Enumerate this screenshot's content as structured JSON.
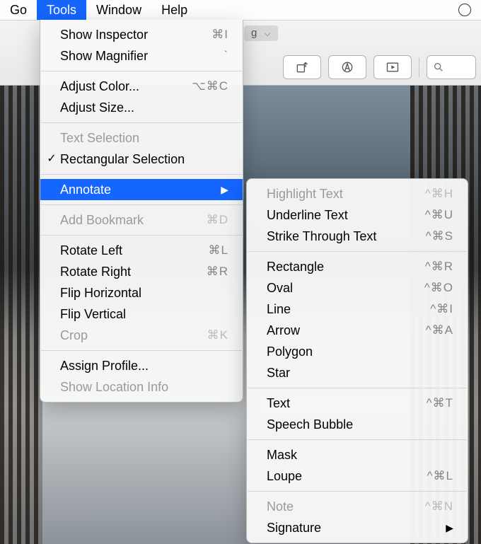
{
  "menubar": {
    "go": "Go",
    "tools": "Tools",
    "window": "Window",
    "help": "Help"
  },
  "toolbar": {
    "filename_partial": "g"
  },
  "tools_menu": {
    "show_inspector": {
      "label": "Show Inspector",
      "shortcut": "⌘I"
    },
    "show_magnifier": {
      "label": "Show Magnifier",
      "shortcut": "`"
    },
    "adjust_color": {
      "label": "Adjust Color...",
      "shortcut": "⌥⌘C"
    },
    "adjust_size": {
      "label": "Adjust Size..."
    },
    "text_selection": {
      "label": "Text Selection"
    },
    "rectangular_selection": {
      "label": "Rectangular Selection"
    },
    "annotate": {
      "label": "Annotate"
    },
    "add_bookmark": {
      "label": "Add Bookmark",
      "shortcut": "⌘D"
    },
    "rotate_left": {
      "label": "Rotate Left",
      "shortcut": "⌘L"
    },
    "rotate_right": {
      "label": "Rotate Right",
      "shortcut": "⌘R"
    },
    "flip_horizontal": {
      "label": "Flip Horizontal"
    },
    "flip_vertical": {
      "label": "Flip Vertical"
    },
    "crop": {
      "label": "Crop",
      "shortcut": "⌘K"
    },
    "assign_profile": {
      "label": "Assign Profile..."
    },
    "show_location_info": {
      "label": "Show Location Info"
    }
  },
  "annotate_menu": {
    "highlight_text": {
      "label": "Highlight Text",
      "shortcut": "^⌘H"
    },
    "underline_text": {
      "label": "Underline Text",
      "shortcut": "^⌘U"
    },
    "strike_through_text": {
      "label": "Strike Through Text",
      "shortcut": "^⌘S"
    },
    "rectangle": {
      "label": "Rectangle",
      "shortcut": "^⌘R"
    },
    "oval": {
      "label": "Oval",
      "shortcut": "^⌘O"
    },
    "line": {
      "label": "Line",
      "shortcut": "^⌘I"
    },
    "arrow": {
      "label": "Arrow",
      "shortcut": "^⌘A"
    },
    "polygon": {
      "label": "Polygon"
    },
    "star": {
      "label": "Star"
    },
    "text": {
      "label": "Text",
      "shortcut": "^⌘T"
    },
    "speech_bubble": {
      "label": "Speech Bubble"
    },
    "mask": {
      "label": "Mask"
    },
    "loupe": {
      "label": "Loupe",
      "shortcut": "^⌘L"
    },
    "note": {
      "label": "Note",
      "shortcut": "^⌘N"
    },
    "signature": {
      "label": "Signature"
    }
  }
}
